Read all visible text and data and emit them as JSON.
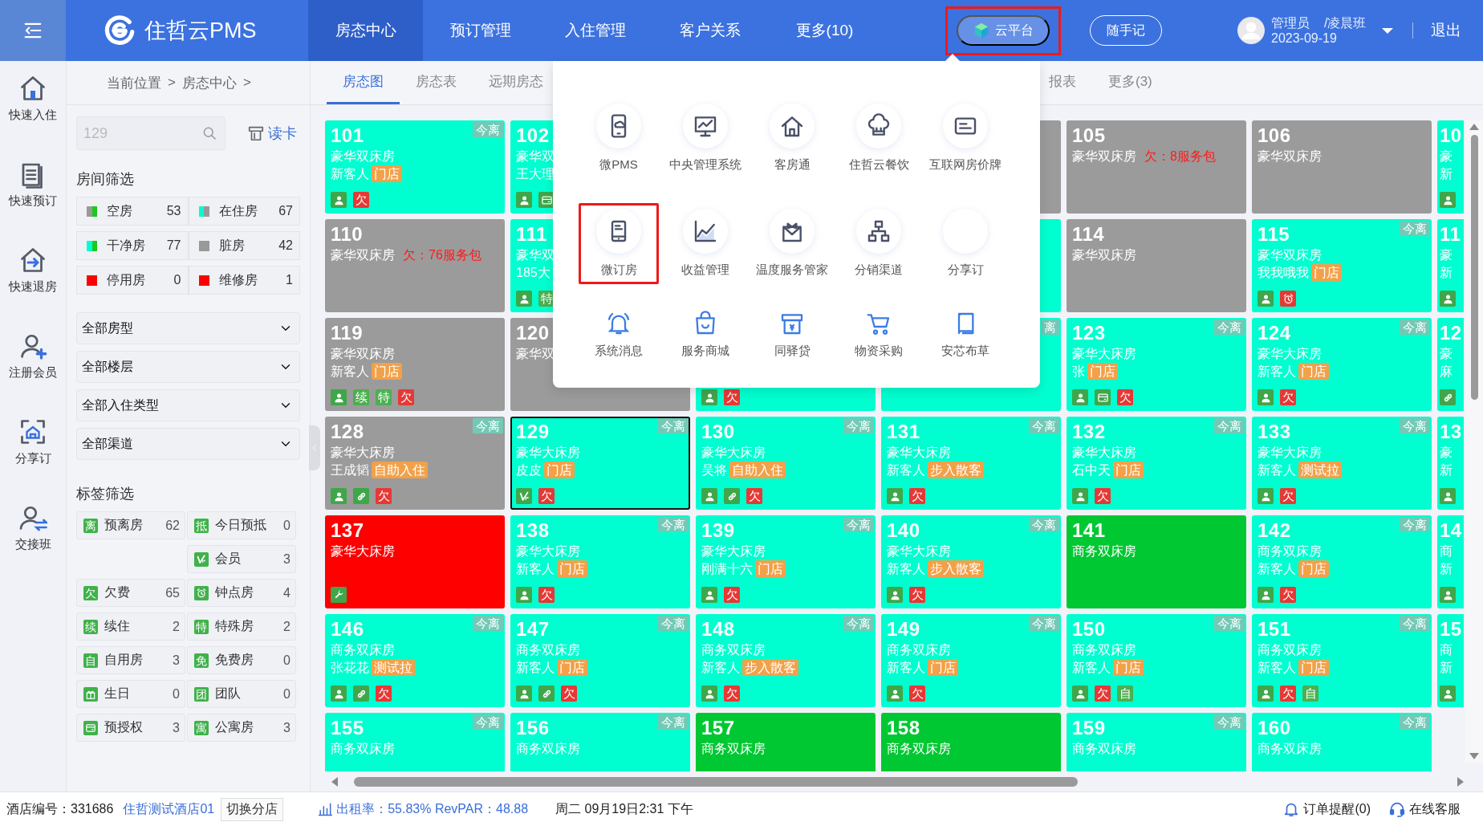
{
  "header": {
    "brand": "住哲云PMS",
    "nav": [
      {
        "label": "房态中心",
        "selected": true
      },
      {
        "label": "预订管理",
        "selected": false
      },
      {
        "label": "入住管理",
        "selected": false
      },
      {
        "label": "客户关系",
        "selected": false
      },
      {
        "label": "更多(10)",
        "selected": false
      }
    ],
    "cloud_button": {
      "label": "云平台",
      "highlighted": true
    },
    "note_button": "随手记",
    "user": {
      "name": "管理员",
      "shift": "/凌晨班",
      "date": "2023-09-19"
    },
    "logout": "退出"
  },
  "quick_actions": [
    {
      "label": "快速入住"
    },
    {
      "label": "快速预订"
    },
    {
      "label": "快速退房"
    },
    {
      "label": "注册会员"
    },
    {
      "label": "分享订"
    },
    {
      "label": "交接班"
    }
  ],
  "breadcrumb": [
    "当前位置",
    ">",
    "房态中心",
    ">"
  ],
  "filters": {
    "search": {
      "placeholder": "129"
    },
    "read_card": "读卡",
    "room_title": "房间筛选",
    "room_items": [
      {
        "label": "空房",
        "count": "53",
        "swatch": [
          {
            "color": "#999999"
          },
          {
            "color": "#1ec81e"
          }
        ]
      },
      {
        "label": "在住房",
        "count": "67",
        "swatch": [
          {
            "color": "#00ffd0"
          },
          {
            "color": "#999999"
          }
        ]
      },
      {
        "label": "干净房",
        "count": "77",
        "swatch": [
          {
            "color": "#00ffd0"
          },
          {
            "color": "#1ec81e"
          }
        ]
      },
      {
        "label": "脏房",
        "count": "42",
        "swatch": [
          {
            "color": "#999999"
          }
        ]
      },
      {
        "label": "停用房",
        "count": "0",
        "swatch": [
          {
            "color": "#ff0000"
          }
        ]
      },
      {
        "label": "维修房",
        "count": "1",
        "swatch": [
          {
            "color": "#ff0000"
          }
        ]
      }
    ],
    "selects": [
      "全部房型",
      "全部楼层",
      "全部入住类型",
      "全部渠道"
    ],
    "tag_title": "标签筛选",
    "tag_rows": [
      [
        {
          "kind": "text",
          "mark": "离",
          "label": "预离房",
          "count": "62"
        },
        {
          "kind": "text",
          "mark": "抵",
          "label": "今日预抵",
          "count": "0"
        }
      ],
      [
        {
          "kind": "member",
          "label": "会员",
          "count": "3"
        }
      ],
      [
        {
          "kind": "text",
          "mark": "欠",
          "label": "欠费",
          "count": "65"
        },
        {
          "kind": "clock",
          "label": "钟点房",
          "count": "4"
        }
      ],
      [
        {
          "kind": "text",
          "mark": "续",
          "label": "续住",
          "count": "2"
        },
        {
          "kind": "text",
          "mark": "特",
          "label": "特殊房",
          "count": "2"
        }
      ],
      [
        {
          "kind": "text",
          "mark": "自",
          "label": "自用房",
          "count": "3"
        },
        {
          "kind": "text",
          "mark": "免",
          "label": "免费房",
          "count": "0"
        }
      ],
      [
        {
          "kind": "gift",
          "label": "生日",
          "count": "0"
        },
        {
          "kind": "text",
          "mark": "团",
          "label": "团队",
          "count": "0"
        }
      ],
      [
        {
          "kind": "card",
          "label": "预授权",
          "count": "3"
        },
        {
          "kind": "text",
          "mark": "寓",
          "label": "公寓房",
          "count": "3"
        }
      ]
    ]
  },
  "tabs": [
    {
      "kind": "tab",
      "label": "房态图",
      "selected": true
    },
    {
      "kind": "tab",
      "label": "房态表",
      "selected": false
    },
    {
      "kind": "tab",
      "label": "远期房态",
      "selected": false
    },
    {
      "kind": "covered"
    },
    {
      "kind": "tab",
      "label": "报表",
      "selected": false
    },
    {
      "kind": "tab",
      "label": "更多(3)",
      "selected": false
    }
  ],
  "grid": {
    "rows": [
      [
        {
          "kind": "room",
          "number": "101",
          "type": "豪华双床房",
          "guest": "新客人",
          "source": "门店",
          "leave": "今离",
          "color": "#00ffd0",
          "selected": false,
          "icons": [
            {
              "kind": "guest"
            },
            {
              "kind": "text",
              "mark": "欠",
              "color": "#e53935"
            }
          ]
        },
        {
          "kind": "room",
          "number": "102",
          "type": "豪华双",
          "guest": "王大理",
          "color": "#00ffd0",
          "selected": false,
          "icons": [
            {
              "kind": "guest"
            },
            {
              "kind": "card"
            }
          ]
        },
        {
          "kind": "covered"
        },
        {
          "kind": "room",
          "color": "#9b9b9b",
          "selected": false
        },
        {
          "kind": "room",
          "number": "105",
          "type": "豪华双床房",
          "debt": "欠：8服务包",
          "color": "#9b9b9b",
          "selected": false
        },
        {
          "kind": "room",
          "number": "106",
          "type": "豪华双床房",
          "color": "#9b9b9b",
          "selected": false
        },
        {
          "kind": "room",
          "number": "10",
          "type": "豪",
          "guest": "新",
          "color": "#00ffd0",
          "selected": false,
          "icons": [
            {
              "kind": "guest"
            }
          ]
        }
      ],
      [
        {
          "kind": "room",
          "number": "110",
          "type": "豪华双床房",
          "debt": "欠：76服务包",
          "color": "#9b9b9b",
          "selected": false
        },
        {
          "kind": "room",
          "number": "111",
          "type": "豪华双",
          "guest": "185大",
          "color": "#00ffd0",
          "selected": false,
          "icons": [
            {
              "kind": "guest"
            },
            {
              "kind": "text",
              "mark": "特",
              "color": "#4caf50"
            }
          ]
        },
        {
          "kind": "covered"
        },
        {
          "kind": "room",
          "color": "#00ffd0",
          "selected": false
        },
        {
          "kind": "room",
          "number": "114",
          "type": "豪华双床房",
          "color": "#9b9b9b",
          "selected": false
        },
        {
          "kind": "room",
          "number": "115",
          "type": "豪华双床房",
          "guest": "我我哦我",
          "source": "门店",
          "leave": "今离",
          "color": "#00ffd0",
          "selected": false,
          "icons": [
            {
              "kind": "guest"
            },
            {
              "kind": "clock"
            }
          ]
        },
        {
          "kind": "room",
          "number": "11",
          "type": "豪",
          "guest": "新",
          "color": "#00ffd0",
          "selected": false,
          "icons": [
            {
              "kind": "guest"
            }
          ]
        }
      ],
      [
        {
          "kind": "room",
          "number": "119",
          "type": "豪华双床房",
          "guest": "新客人",
          "source": "门店",
          "color": "#9b9b9b",
          "selected": false,
          "icons": [
            {
              "kind": "guest"
            },
            {
              "kind": "text",
              "mark": "续",
              "color": "#4caf50"
            },
            {
              "kind": "text",
              "mark": "特",
              "color": "#4caf50"
            },
            {
              "kind": "text",
              "mark": "欠",
              "color": "#e53935"
            }
          ]
        },
        {
          "kind": "room",
          "number": "120",
          "type": "豪华双",
          "color": "#9b9b9b",
          "selected": false
        },
        {
          "kind": "room",
          "color": "#00ffd0",
          "selected": false,
          "icons": [
            {
              "kind": "guest"
            },
            {
              "kind": "text",
              "mark": "欠",
              "color": "#e53935"
            }
          ]
        },
        {
          "kind": "room",
          "leave": "离",
          "color": "#00ffd0",
          "selected": false
        },
        {
          "kind": "room",
          "number": "123",
          "type": "豪华大床房",
          "guest": "张",
          "source": "门店",
          "leave": "今离",
          "color": "#00ffd0",
          "selected": false,
          "icons": [
            {
              "kind": "guest"
            },
            {
              "kind": "card"
            },
            {
              "kind": "text",
              "mark": "欠",
              "color": "#e53935"
            }
          ]
        },
        {
          "kind": "room",
          "number": "124",
          "type": "豪华大床房",
          "guest": "新客人",
          "source": "门店",
          "leave": "今离",
          "color": "#00ffd0",
          "selected": false,
          "icons": [
            {
              "kind": "guest"
            },
            {
              "kind": "text",
              "mark": "欠",
              "color": "#e53935"
            }
          ]
        },
        {
          "kind": "room",
          "number": "12",
          "type": "豪",
          "guest": "麻",
          "color": "#00ffd0",
          "selected": false,
          "icons": [
            {
              "kind": "link"
            }
          ]
        }
      ],
      [
        {
          "kind": "room",
          "number": "128",
          "type": "豪华大床房",
          "guest": "王成韬",
          "source": "自助入住",
          "leave": "今离",
          "color": "#9b9b9b",
          "selected": false,
          "icons": [
            {
              "kind": "guest"
            },
            {
              "kind": "link"
            },
            {
              "kind": "text",
              "mark": "欠",
              "color": "#e53935"
            }
          ]
        },
        {
          "kind": "room",
          "number": "129",
          "type": "豪华大床房",
          "guest": "皮皮",
          "source": "门店",
          "leave": "今离",
          "color": "#00ffd0",
          "selected": true,
          "icons": [
            {
              "kind": "member"
            },
            {
              "kind": "text",
              "mark": "欠",
              "color": "#e53935"
            }
          ]
        },
        {
          "kind": "room",
          "number": "130",
          "type": "豪华大床房",
          "guest": "吴将",
          "source": "自助入住",
          "leave": "今离",
          "color": "#00ffd0",
          "selected": false,
          "icons": [
            {
              "kind": "guest"
            },
            {
              "kind": "link"
            },
            {
              "kind": "text",
              "mark": "欠",
              "color": "#e53935"
            }
          ]
        },
        {
          "kind": "room",
          "number": "131",
          "type": "豪华大床房",
          "guest": "新客人",
          "source": "步入散客",
          "leave": "今离",
          "color": "#00ffd0",
          "selected": false,
          "icons": [
            {
              "kind": "guest"
            },
            {
              "kind": "text",
              "mark": "欠",
              "color": "#e53935"
            }
          ]
        },
        {
          "kind": "room",
          "number": "132",
          "type": "豪华大床房",
          "guest": "石中天",
          "source": "门店",
          "leave": "今离",
          "color": "#00ffd0",
          "selected": false,
          "icons": [
            {
              "kind": "guest"
            },
            {
              "kind": "text",
              "mark": "欠",
              "color": "#e53935"
            }
          ]
        },
        {
          "kind": "room",
          "number": "133",
          "type": "豪华大床房",
          "guest": "新客人",
          "source": "测试拉",
          "leave": "今离",
          "color": "#00ffd0",
          "selected": false,
          "icons": [
            {
              "kind": "guest"
            },
            {
              "kind": "text",
              "mark": "欠",
              "color": "#e53935"
            }
          ]
        },
        {
          "kind": "room",
          "number": "13",
          "type": "豪",
          "guest": "新",
          "color": "#00ffd0",
          "selected": false,
          "icons": [
            {
              "kind": "guest"
            }
          ]
        }
      ],
      [
        {
          "kind": "room",
          "number": "137",
          "type": "豪华大床房",
          "color": "#ff0000",
          "selected": false,
          "icons": [
            {
              "kind": "wrench"
            }
          ]
        },
        {
          "kind": "room",
          "number": "138",
          "type": "豪华大床房",
          "guest": "新客人",
          "source": "门店",
          "leave": "今离",
          "color": "#00ffd0",
          "selected": false,
          "icons": [
            {
              "kind": "guest"
            },
            {
              "kind": "text",
              "mark": "欠",
              "color": "#e53935"
            }
          ]
        },
        {
          "kind": "room",
          "number": "139",
          "type": "豪华大床房",
          "guest": "刚满十六",
          "source": "门店",
          "leave": "今离",
          "color": "#00ffd0",
          "selected": false,
          "icons": [
            {
              "kind": "guest"
            },
            {
              "kind": "text",
              "mark": "欠",
              "color": "#e53935"
            }
          ]
        },
        {
          "kind": "room",
          "number": "140",
          "type": "豪华大床房",
          "guest": "新客人",
          "source": "步入散客",
          "leave": "今离",
          "color": "#00ffd0",
          "selected": false,
          "icons": [
            {
              "kind": "guest"
            },
            {
              "kind": "text",
              "mark": "欠",
              "color": "#e53935"
            }
          ]
        },
        {
          "kind": "room",
          "number": "141",
          "type": "商务双床房",
          "color": "#00c832",
          "selected": false
        },
        {
          "kind": "room",
          "number": "142",
          "type": "商务双床房",
          "guest": "新客人",
          "source": "门店",
          "leave": "今离",
          "color": "#00ffd0",
          "selected": false,
          "icons": [
            {
              "kind": "guest"
            },
            {
              "kind": "text",
              "mark": "欠",
              "color": "#e53935"
            }
          ]
        },
        {
          "kind": "room",
          "number": "14",
          "type": "商",
          "guest": "新",
          "color": "#00ffd0",
          "selected": false,
          "icons": [
            {
              "kind": "guest"
            }
          ]
        }
      ],
      [
        {
          "kind": "room",
          "number": "146",
          "type": "商务双床房",
          "guest": "张花花",
          "source": "测试拉",
          "leave": "今离",
          "color": "#00ffd0",
          "selected": false,
          "icons": [
            {
              "kind": "guest"
            },
            {
              "kind": "link"
            },
            {
              "kind": "text",
              "mark": "欠",
              "color": "#e53935"
            }
          ]
        },
        {
          "kind": "room",
          "number": "147",
          "type": "商务双床房",
          "guest": "新客人",
          "source": "门店",
          "leave": "今离",
          "color": "#00ffd0",
          "selected": false,
          "icons": [
            {
              "kind": "guest"
            },
            {
              "kind": "link"
            },
            {
              "kind": "text",
              "mark": "欠",
              "color": "#e53935"
            }
          ]
        },
        {
          "kind": "room",
          "number": "148",
          "type": "商务双床房",
          "guest": "新客人",
          "source": "步入散客",
          "leave": "今离",
          "color": "#00ffd0",
          "selected": false,
          "icons": [
            {
              "kind": "guest"
            },
            {
              "kind": "text",
              "mark": "欠",
              "color": "#e53935"
            }
          ]
        },
        {
          "kind": "room",
          "number": "149",
          "type": "商务双床房",
          "guest": "新客人",
          "source": "门店",
          "leave": "今离",
          "color": "#00ffd0",
          "selected": false,
          "icons": [
            {
              "kind": "guest"
            },
            {
              "kind": "text",
              "mark": "欠",
              "color": "#e53935"
            }
          ]
        },
        {
          "kind": "room",
          "number": "150",
          "type": "商务双床房",
          "guest": "新客人",
          "source": "门店",
          "leave": "今离",
          "color": "#00ffd0",
          "selected": false,
          "icons": [
            {
              "kind": "guest"
            },
            {
              "kind": "text",
              "mark": "欠",
              "color": "#e53935"
            },
            {
              "kind": "text",
              "mark": "自",
              "color": "#4caf50"
            }
          ]
        },
        {
          "kind": "room",
          "number": "151",
          "type": "商务双床房",
          "guest": "新客人",
          "source": "门店",
          "leave": "今离",
          "color": "#00ffd0",
          "selected": false,
          "icons": [
            {
              "kind": "guest"
            },
            {
              "kind": "text",
              "mark": "欠",
              "color": "#e53935"
            },
            {
              "kind": "text",
              "mark": "自",
              "color": "#4caf50"
            }
          ]
        },
        {
          "kind": "room",
          "number": "15",
          "type": "商",
          "guest": "新",
          "color": "#00ffd0",
          "selected": false,
          "icons": [
            {
              "kind": "guest"
            }
          ]
        }
      ],
      [
        {
          "kind": "room",
          "number": "155",
          "type": "商务双床房",
          "leave": "今离",
          "color": "#00ffd0",
          "selected": false
        },
        {
          "kind": "room",
          "number": "156",
          "type": "商务双床房",
          "leave": "今离",
          "color": "#00ffd0",
          "selected": false
        },
        {
          "kind": "room",
          "number": "157",
          "type": "商务双床房",
          "color": "#00c832",
          "selected": false
        },
        {
          "kind": "room",
          "number": "158",
          "type": "商务双床房",
          "color": "#00c832",
          "selected": false
        },
        {
          "kind": "room",
          "number": "159",
          "type": "商务双床房",
          "leave": "今离",
          "color": "#00ffd0",
          "selected": false
        },
        {
          "kind": "room",
          "number": "160",
          "type": "商务双床房",
          "leave": "今离",
          "color": "#00ffd0",
          "selected": false
        }
      ]
    ]
  },
  "cloud_menu": {
    "rows": [
      [
        {
          "kind": "circle",
          "label": "微PMS",
          "highlighted": false
        },
        {
          "kind": "circle",
          "label": "中央管理系统",
          "highlighted": false
        },
        {
          "kind": "circle",
          "label": "客房通",
          "highlighted": false
        },
        {
          "kind": "circle",
          "label": "住哲云餐饮",
          "highlighted": false
        },
        {
          "kind": "circle",
          "label": "互联网房价牌",
          "highlighted": false
        }
      ],
      [
        {
          "kind": "circle",
          "label": "微订房",
          "highlighted": true
        },
        {
          "kind": "circle",
          "label": "收益管理",
          "highlighted": false
        },
        {
          "kind": "circle",
          "label": "温度服务管家",
          "highlighted": false
        },
        {
          "kind": "circle",
          "label": "分销渠道",
          "highlighted": false
        },
        {
          "kind": "circle",
          "label": "分享订",
          "highlighted": false
        }
      ],
      [
        {
          "kind": "plain",
          "label": "系统消息",
          "highlighted": false
        },
        {
          "kind": "plain",
          "label": "服务商城",
          "highlighted": false
        },
        {
          "kind": "plain",
          "label": "同驿贷",
          "highlighted": false
        },
        {
          "kind": "plain",
          "label": "物资采购",
          "highlighted": false
        },
        {
          "kind": "plain",
          "label": "安芯布草",
          "highlighted": false
        }
      ]
    ]
  },
  "status_bar": {
    "hotel_code": "酒店编号：331686",
    "hotel_name": "住哲测试酒店01",
    "switch_button": "切换分店",
    "occupancy": "出租率：55.83% RevPAR：48.88",
    "datetime": "周二 09月19日2:31 下午",
    "order_alert": "订单提醒(0)",
    "support": "在线客服"
  }
}
